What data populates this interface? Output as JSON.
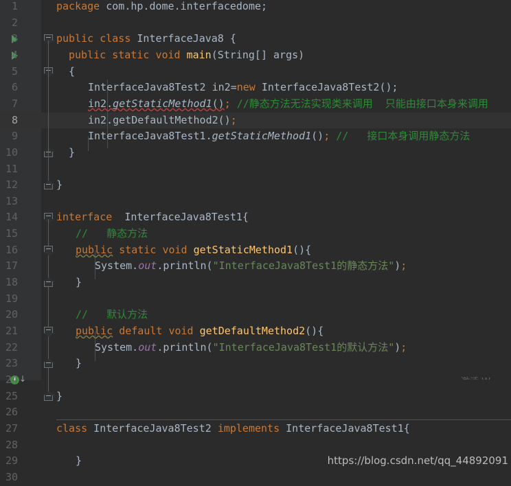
{
  "editor": {
    "theme": "darcula",
    "background": "#2b2b2b",
    "gutter_background": "#313335",
    "current_line_background": "#323232",
    "line_number_color": "#606366",
    "accent_keyword": "#cc7832",
    "accent_string": "#6a8759",
    "accent_comment": "#629755",
    "accent_method": "#ffc66d",
    "accent_field": "#9876aa",
    "accent_text": "#a9b7c6",
    "run_arrow_color": "#499c54"
  },
  "line_numbers": [
    "1",
    "2",
    "3",
    "4",
    "5",
    "6",
    "7",
    "8",
    "9",
    "10",
    "11",
    "12",
    "13",
    "14",
    "15",
    "16",
    "17",
    "18",
    "19",
    "20",
    "21",
    "22",
    "23",
    "24",
    "25",
    "26",
    "27",
    "28",
    "29",
    "30"
  ],
  "current_line": 8,
  "gutter_icons": [
    {
      "line": 3,
      "name": "run-class-arrow",
      "glyph": "▶"
    },
    {
      "line": 4,
      "name": "run-main-arrow",
      "glyph": "▶"
    },
    {
      "line": 24,
      "name": "implemented-by-icon",
      "glyph": "I",
      "sub": "↓"
    }
  ],
  "code_lines": {
    "l1_package": "package",
    "l1_name": " com.hp.dome.interfacedome;",
    "l3_public": "public",
    "l3_class": "class",
    "l3_name": " InterfaceJava8 {",
    "l4_public": "public",
    "l4_static": "static",
    "l4_void": "void",
    "l4_main": "main",
    "l4_args": "(String[] args)",
    "l5_brace": "{",
    "l6_type": "InterfaceJava8Test2 in2=",
    "l6_new": "new",
    "l6_ctor": " InterfaceJava8Test2();",
    "l7_call_a": "in2.",
    "l7_call_b": "getStaticMethod1",
    "l7_call_c": "()",
    "l7_semi": ";",
    "l7_comment": " //静态方法无法实现类来调用  只能由接口本身来调用",
    "l8_call": "in2.getDefaultMethod2()",
    "l8_semi": ";",
    "l9_cls": "InterfaceJava8Test1.",
    "l9_call": "getStaticMethod1",
    "l9_paren": "()",
    "l9_semi": ";",
    "l9_comment": " //   接口本身调用静态方法",
    "l10_brace": "}",
    "l12_brace": "}",
    "l14_interface": "interface",
    "l14_name": "  InterfaceJava8Test1{",
    "l15_comment": "//   静态方法",
    "l16_public": "public",
    "l16_static": "static",
    "l16_void": "void",
    "l16_name": "getStaticMethod1",
    "l16_tail": "(){",
    "l17_sys": "System.",
    "l17_out": "out",
    "l17_println": ".println(",
    "l17_str": "\"InterfaceJava8Test1的静态方法\"",
    "l17_tail": ")",
    "l17_semi": ";",
    "l18_brace": "}",
    "l20_comment": "//   默认方法",
    "l21_public": "public",
    "l21_default": "default",
    "l21_void": "void",
    "l21_name": "getDefaultMethod2",
    "l21_tail": "(){",
    "l22_sys": "System.",
    "l22_out": "out",
    "l22_println": ".println(",
    "l22_str": "\"InterfaceJava8Test1的默认方法\"",
    "l22_tail": ")",
    "l22_semi": ";",
    "l23_brace": "}",
    "l25_brace": "}",
    "l27_class": "class",
    "l27_name": " InterfaceJava8Test2 ",
    "l27_implements": "implements",
    "l27_iface": " InterfaceJava8Test1{",
    "l29_brace": "}"
  },
  "watermark": {
    "url": "https://blog.csdn.net/qq_44892091",
    "subtext": "激活 W"
  }
}
